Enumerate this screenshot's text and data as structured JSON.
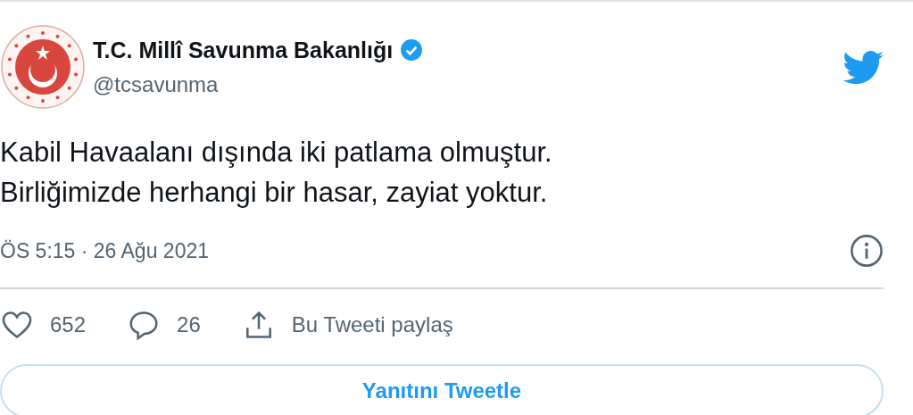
{
  "author": {
    "name": "T.C. Millî Savunma Bakanlığı",
    "verified": true,
    "handle": "@tcsavunma"
  },
  "tweet": {
    "lines": [
      "Kabil Havaalanı dışında iki patlama olmuştur.",
      "Birliğimizde herhangi bir hasar, zayiat yoktur."
    ],
    "timestamp": "ÖS 5:15 · 26 Ağu 2021"
  },
  "actions": [
    {
      "kind": "like",
      "label": "652"
    },
    {
      "kind": "reply",
      "label": "26"
    },
    {
      "kind": "share",
      "label": "Bu Tweeti paylaş"
    }
  ],
  "reply_button": "Yanıtını Tweetle"
}
